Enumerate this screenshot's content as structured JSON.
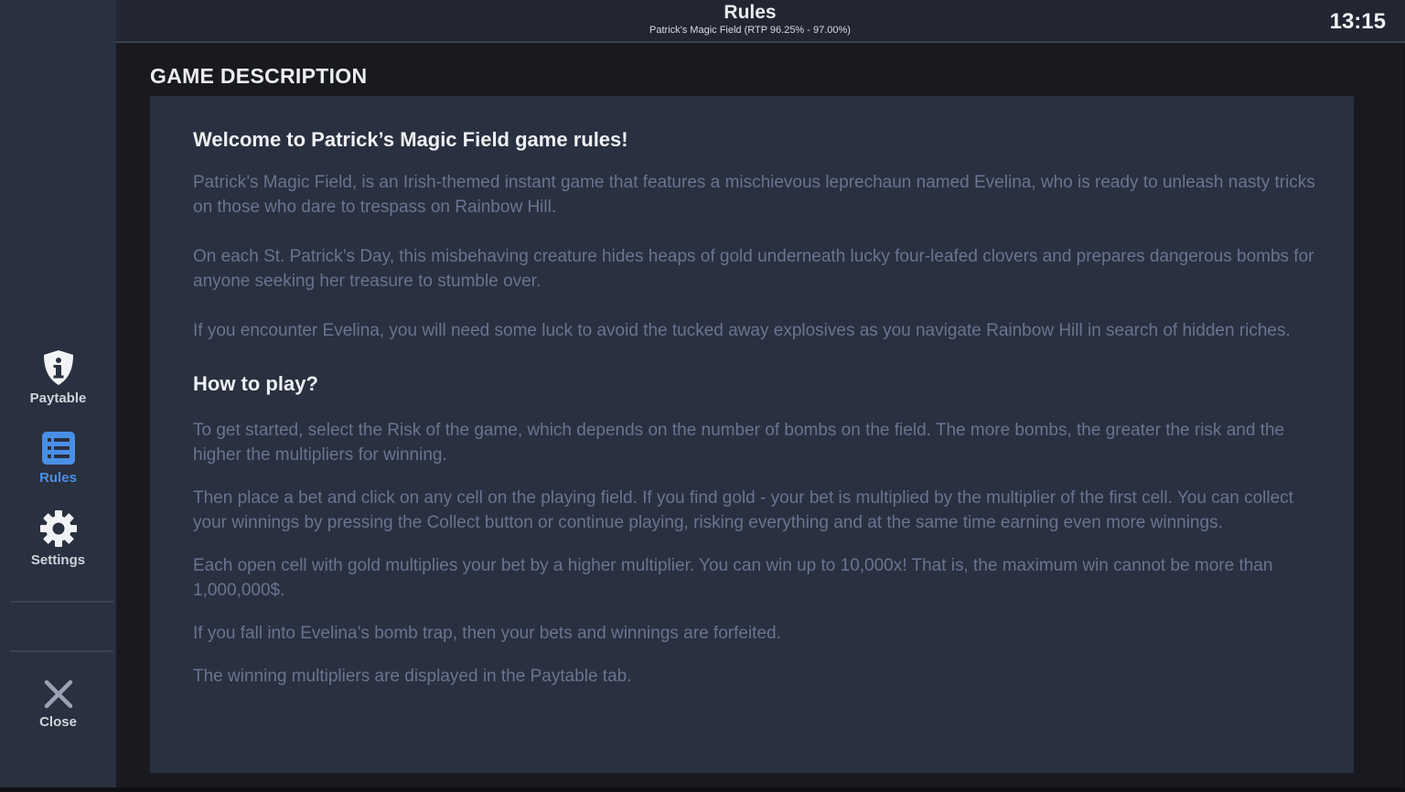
{
  "header": {
    "title": "Rules",
    "subtitle": "Patrick's Magic Field (RTP 96.25% - 97.00%)",
    "clock": "13:15"
  },
  "sidebar": {
    "items": [
      {
        "id": "paytable",
        "label": "Paytable",
        "icon": "shield-info-icon",
        "active": false
      },
      {
        "id": "rules",
        "label": "Rules",
        "icon": "list-icon",
        "active": true
      },
      {
        "id": "settings",
        "label": "Settings",
        "icon": "gear-icon",
        "active": false
      }
    ],
    "close_label": "Close",
    "active_color": "#4a8fe6"
  },
  "main": {
    "section_title": "GAME DESCRIPTION",
    "welcome_heading": "Welcome to Patrick’s Magic Field game rules!",
    "intro_paragraphs": [
      "Patrick’s Magic Field, is an Irish-themed instant game that features a mischievous leprechaun named Evelina, who is ready to unleash nasty tricks on those who dare to trespass on Rainbow Hill.",
      "On each St. Patrick’s Day, this misbehaving creature hides heaps of gold underneath lucky four-leafed clovers and prepares dangerous bombs for anyone seeking her treasure to stumble over.",
      "If you encounter Evelina, you will need some luck to avoid the tucked away explosives as you navigate Rainbow Hill in search of hidden riches."
    ],
    "how_to_play_heading": "How to play?",
    "how_to_play_paragraphs": [
      "To get started, select the Risk of the game, which depends on the number of bombs on the field. The more bombs, the greater the risk and the higher the multipliers for winning.",
      "Then place a bet and click on any cell on the playing field. If you find gold - your bet is multiplied by the multiplier of the first cell. You can collect your winnings by pressing the Collect button or continue playing, risking everything and at the same time earning even more winnings.",
      "Each open cell with gold multiplies your bet by a higher multiplier. You can win up to 10,000x! That is, the maximum win cannot be more than 1,000,000$.",
      "If you fall into Evelina’s bomb trap, then your bets and winnings are forfeited.",
      "The winning multipliers are displayed in the Paytable tab."
    ]
  }
}
